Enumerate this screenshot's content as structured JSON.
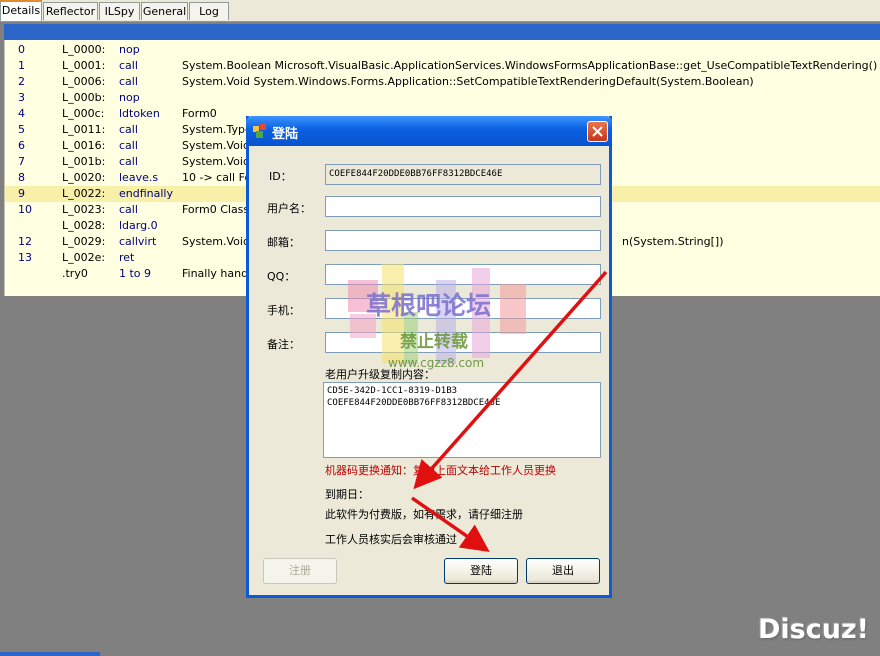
{
  "tabs": [
    "Details",
    "Reflector",
    "ILSpy",
    "General",
    "Log"
  ],
  "code_rows": [
    {
      "idx": "0",
      "label": "L_0000:",
      "op": "nop",
      "arg": "",
      "arg_right": ""
    },
    {
      "idx": "1",
      "label": "L_0001:",
      "op": "call",
      "arg": "System.Boolean Microsoft.VisualBasic.ApplicationServices.WindowsFormsApplicationBase::get_UseCompatibleTextRendering()",
      "arg_right": ""
    },
    {
      "idx": "2",
      "label": "L_0006:",
      "op": "call",
      "arg": "System.Void System.Windows.Forms.Application::SetCompatibleTextRenderingDefault(System.Boolean)",
      "arg_right": ""
    },
    {
      "idx": "3",
      "label": "L_000b:",
      "op": "nop",
      "arg": "",
      "arg_right": ""
    },
    {
      "idx": "4",
      "label": "L_000c:",
      "op": "ldtoken",
      "arg": "Form0",
      "arg_right": ""
    },
    {
      "idx": "5",
      "label": "L_0011:",
      "op": "call",
      "arg": "System.Type",
      "arg_right": ""
    },
    {
      "idx": "6",
      "label": "L_0016:",
      "op": "call",
      "arg": "System.Void S",
      "arg_right": ""
    },
    {
      "idx": "7",
      "label": "L_001b:",
      "op": "call",
      "arg": "System.Void C",
      "arg_right": ""
    },
    {
      "idx": "8",
      "label": "L_0020:",
      "op": "leave.s",
      "arg": "10 -> call For",
      "arg_right": ""
    },
    {
      "idx": "9",
      "label": "L_0022:",
      "op": "endfinally",
      "arg": "",
      "arg_right": ""
    },
    {
      "idx": "10",
      "label": "L_0023:",
      "op": "call",
      "arg": "Form0 Class2",
      "arg_right": ""
    },
    {
      "idx": "",
      "label": "L_0028:",
      "op": "ldarg.0",
      "arg": "",
      "arg_right": ""
    },
    {
      "idx": "12",
      "label": "L_0029:",
      "op": "callvirt",
      "arg": "System.Void N",
      "arg_right": "n(System.String[])"
    },
    {
      "idx": "13",
      "label": "L_002e:",
      "op": "ret",
      "arg": "",
      "arg_right": ""
    },
    {
      "idx": "",
      "label": ".try0",
      "op": "1 to 9",
      "arg": "Finally handle",
      "arg_right": ""
    }
  ],
  "dialog": {
    "title": "登陆",
    "id_label": "ID：",
    "id_value": "COEFE844F20DDE0BB76FF8312BDCE46E",
    "username_label": "用户名：",
    "username_value": "",
    "email_label": "邮箱：",
    "email_value": "",
    "qq_label": "QQ：",
    "qq_value": "",
    "phone_label": "手机：",
    "phone_value": "",
    "note_label": "备注：",
    "note_value": "",
    "upgrade_label": "老用户升级复制内容：",
    "upgrade_lines": [
      "CD5E-342D-1CC1-8319-D1B3",
      "COEFE844F20DDE0BB76FF8312BDCE46E"
    ],
    "machine_code_notice": "机器码更换通知：复制上面文本给工作人员更换",
    "expiry_label": "到期日：",
    "paid_notice": "此软件为付费版，如有需求，请仔细注册",
    "review_notice": "工作人员核实后会审核通过",
    "register_button": "注册",
    "login_button": "登陆",
    "exit_button": "退出"
  },
  "watermark": {
    "title": "草根吧论坛",
    "subtitle": "禁止转载",
    "url": "www.cgzz8.com"
  },
  "colors": {
    "arrow": "#e01010",
    "code_bg": "#ffffe1",
    "highlight_row": "#f8f0a8",
    "titlebar": "#0a5fe0"
  },
  "forum_logo": "Discuz!"
}
